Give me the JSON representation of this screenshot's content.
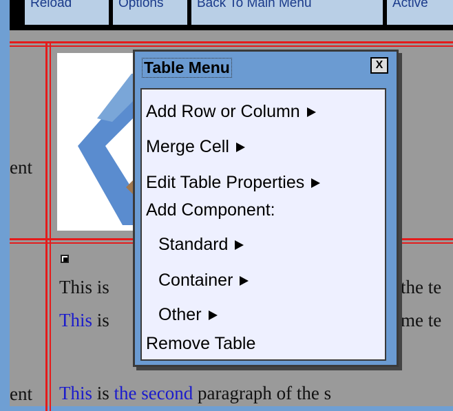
{
  "toolbar": {
    "buttons": [
      {
        "label": "Reload"
      },
      {
        "label": "Options"
      },
      {
        "label": "Back To Main Menu"
      },
      {
        "label": "Active"
      }
    ]
  },
  "table_cells": {
    "left_col_text_1": "ent",
    "left_col_text_2": "ent",
    "para1_a": "This is",
    "para1_b": "the te",
    "para2_link": "This",
    "para2_a": " is",
    "para2_b": "me te",
    "para3_link1": "This",
    "para3_mid": " is ",
    "para3_link2": "the second",
    "para3_end": " paragraph of the s"
  },
  "menu": {
    "title": "Table Menu",
    "close_label": "X",
    "items": [
      {
        "label": "Add Row or Column",
        "has_submenu": true
      },
      {
        "label": "Merge Cell",
        "has_submenu": true
      },
      {
        "label": "Edit Table Properties",
        "has_submenu": true
      },
      {
        "label": "Add Component:",
        "has_submenu": false
      },
      {
        "label": "Standard",
        "has_submenu": true
      },
      {
        "label": "Container",
        "has_submenu": true
      },
      {
        "label": "Other",
        "has_submenu": true
      },
      {
        "label": "Remove Table",
        "has_submenu": false
      }
    ]
  },
  "colors": {
    "frame": "#6f9fd3",
    "grid_line": "#e41b1b",
    "link": "#1b1bcc",
    "menu_bg": "#eef0ff",
    "menu_header": "#6b9bd2"
  }
}
